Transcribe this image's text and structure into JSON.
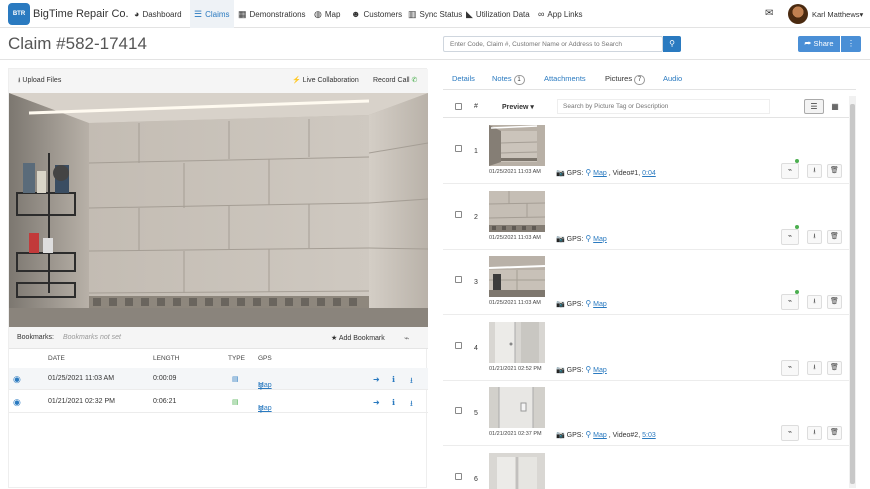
{
  "brand": "BigTime Repair Co.",
  "logo_text": "BTR",
  "nav": [
    {
      "label": "Dashboard",
      "icon": "dashboard-icon",
      "glyph": "◕"
    },
    {
      "label": "Claims",
      "icon": "claims-icon",
      "glyph": "☰"
    },
    {
      "label": "Demonstrations",
      "icon": "film-icon",
      "glyph": "▦"
    },
    {
      "label": "Map",
      "icon": "globe-icon",
      "glyph": "◍"
    },
    {
      "label": "Customers",
      "icon": "users-icon",
      "glyph": "☻"
    },
    {
      "label": "Sync Status",
      "icon": "bar-chart-icon",
      "glyph": "▥"
    },
    {
      "label": "Utilization Data",
      "icon": "area-chart-icon",
      "glyph": "◣"
    },
    {
      "label": "App Links",
      "icon": "link-icon",
      "glyph": "∞"
    }
  ],
  "active_nav": "Claims",
  "user": {
    "name": "Karl Matthews"
  },
  "claim_title": "Claim #582-17414",
  "search": {
    "placeholder": "Enter Code, Claim #, Customer Name or Address to Search"
  },
  "share_label": "Share",
  "left": {
    "upload_label": "Upload Files",
    "live_collab_label": "Live Collaboration",
    "record_call_label": "Record Call",
    "bookmarks_label": "Bookmarks:",
    "bookmarks_empty": "Bookmarks not set",
    "add_bookmark_label": "Add Bookmark",
    "columns": [
      "DATE",
      "LENGTH",
      "TYPE",
      "GPS"
    ],
    "recordings": [
      {
        "date": "01/25/2021 11:03 AM",
        "length": "0:00:09",
        "gps": "Map"
      },
      {
        "date": "01/21/2021 02:32 PM",
        "length": "0:06:21",
        "gps": "Map"
      }
    ]
  },
  "right": {
    "tabs": [
      {
        "label": "Details"
      },
      {
        "label": "Notes",
        "count": "1"
      },
      {
        "label": "Attachments"
      },
      {
        "label": "Pictures",
        "count": "7"
      },
      {
        "label": "Audio"
      }
    ],
    "active_tab": "Pictures",
    "grid_header": {
      "num": "#",
      "preview": "Preview",
      "search_placeholder": "Search by Picture Tag or Description"
    },
    "pictures": [
      {
        "num": "1",
        "date": "01/25/2021 11:03 AM",
        "gps_label": "GPS:",
        "map": "Map",
        "video_label": ", Video#1,",
        "video_time": "0:04",
        "tagged": true
      },
      {
        "num": "2",
        "date": "01/25/2021 11:03 AM",
        "gps_label": "GPS:",
        "map": "Map",
        "video_label": "",
        "video_time": "",
        "tagged": true
      },
      {
        "num": "3",
        "date": "01/25/2021 11:03 AM",
        "gps_label": "GPS:",
        "map": "Map",
        "video_label": "",
        "video_time": "",
        "tagged": true
      },
      {
        "num": "4",
        "date": "01/21/2021 02:52 PM",
        "gps_label": "GPS:",
        "map": "Map",
        "video_label": "",
        "video_time": "",
        "tagged": false
      },
      {
        "num": "5",
        "date": "01/21/2021 02:37 PM",
        "gps_label": "GPS:",
        "map": "Map",
        "video_label": ", Video#2,",
        "video_time": "5:03",
        "tagged": false
      },
      {
        "num": "6",
        "date": "",
        "gps_label": "",
        "map": "",
        "video_label": "",
        "video_time": "",
        "tagged": false
      }
    ]
  }
}
